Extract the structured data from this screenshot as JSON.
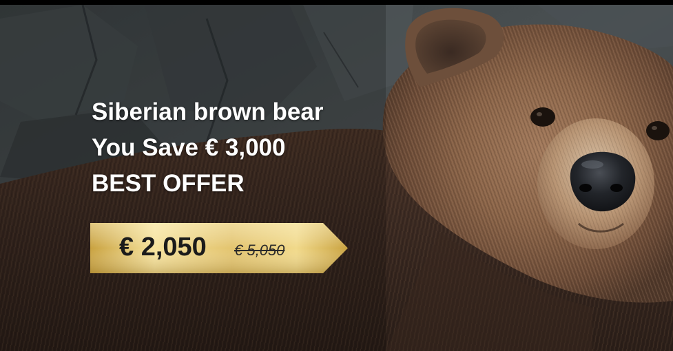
{
  "ad": {
    "product_name": "Siberian brown bear",
    "savings_text": "You Save € 3,000",
    "tagline": "BEST OFFER"
  },
  "price_tag": {
    "current_price": "€ 2,050",
    "original_price": "€ 5,050"
  },
  "colors": {
    "tag_gold_light": "#f6e29c",
    "tag_gold_dark": "#c9a23f",
    "text_white": "#ffffff",
    "fur_brown": "#5a3f2c"
  }
}
